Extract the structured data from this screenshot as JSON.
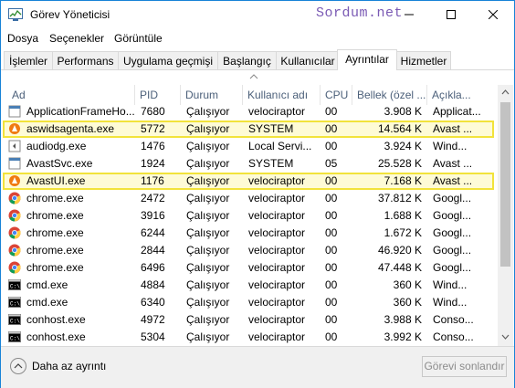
{
  "window": {
    "title": "Görev Yöneticisi",
    "watermark": "Sordum.net"
  },
  "menu": [
    "Dosya",
    "Seçenekler",
    "Görüntüle"
  ],
  "tabs": [
    "İşlemler",
    "Performans",
    "Uygulama geçmişi",
    "Başlangıç",
    "Kullanıcılar",
    "Ayrıntılar",
    "Hizmetler"
  ],
  "active_tab": "Ayrıntılar",
  "columns": [
    "Ad",
    "PID",
    "Durum",
    "Kullanıcı adı",
    "CPU",
    "Bellek (özel ...",
    "Açıkla..."
  ],
  "rows": [
    {
      "name": "ApplicationFrameHo...",
      "pid": "7680",
      "status": "Çalışıyor",
      "user": "velociraptor",
      "cpu": "00",
      "mem": "3.908 K",
      "desc": "Applicat...",
      "icon": "app-frame-icon",
      "highlight": false
    },
    {
      "name": "aswidsagenta.exe",
      "pid": "5772",
      "status": "Çalışıyor",
      "user": "SYSTEM",
      "cpu": "00",
      "mem": "14.564 K",
      "desc": "Avast ...",
      "icon": "avast-icon",
      "highlight": true
    },
    {
      "name": "audiodg.exe",
      "pid": "1476",
      "status": "Çalışıyor",
      "user": "Local Servi...",
      "cpu": "00",
      "mem": "3.924 K",
      "desc": "Wind...",
      "icon": "audio-icon",
      "highlight": false
    },
    {
      "name": "AvastSvc.exe",
      "pid": "1924",
      "status": "Çalışıyor",
      "user": "SYSTEM",
      "cpu": "05",
      "mem": "25.528 K",
      "desc": "Avast ...",
      "icon": "app-frame-icon",
      "highlight": false
    },
    {
      "name": "AvastUI.exe",
      "pid": "1176",
      "status": "Çalışıyor",
      "user": "velociraptor",
      "cpu": "00",
      "mem": "7.168 K",
      "desc": "Avast ...",
      "icon": "avast-icon",
      "highlight": true
    },
    {
      "name": "chrome.exe",
      "pid": "2472",
      "status": "Çalışıyor",
      "user": "velociraptor",
      "cpu": "00",
      "mem": "37.812 K",
      "desc": "Googl...",
      "icon": "chrome-icon",
      "highlight": false
    },
    {
      "name": "chrome.exe",
      "pid": "3916",
      "status": "Çalışıyor",
      "user": "velociraptor",
      "cpu": "00",
      "mem": "1.688 K",
      "desc": "Googl...",
      "icon": "chrome-icon",
      "highlight": false
    },
    {
      "name": "chrome.exe",
      "pid": "6244",
      "status": "Çalışıyor",
      "user": "velociraptor",
      "cpu": "00",
      "mem": "1.672 K",
      "desc": "Googl...",
      "icon": "chrome-icon",
      "highlight": false
    },
    {
      "name": "chrome.exe",
      "pid": "2844",
      "status": "Çalışıyor",
      "user": "velociraptor",
      "cpu": "00",
      "mem": "46.920 K",
      "desc": "Googl...",
      "icon": "chrome-icon",
      "highlight": false
    },
    {
      "name": "chrome.exe",
      "pid": "6496",
      "status": "Çalışıyor",
      "user": "velociraptor",
      "cpu": "00",
      "mem": "47.448 K",
      "desc": "Googl...",
      "icon": "chrome-icon",
      "highlight": false
    },
    {
      "name": "cmd.exe",
      "pid": "4884",
      "status": "Çalışıyor",
      "user": "velociraptor",
      "cpu": "00",
      "mem": "360 K",
      "desc": "Wind...",
      "icon": "cmd-icon",
      "highlight": false
    },
    {
      "name": "cmd.exe",
      "pid": "6340",
      "status": "Çalışıyor",
      "user": "velociraptor",
      "cpu": "00",
      "mem": "360 K",
      "desc": "Wind...",
      "icon": "cmd-icon",
      "highlight": false
    },
    {
      "name": "conhost.exe",
      "pid": "4972",
      "status": "Çalışıyor",
      "user": "velociraptor",
      "cpu": "00",
      "mem": "3.988 K",
      "desc": "Conso...",
      "icon": "cmd-icon",
      "highlight": false
    },
    {
      "name": "conhost.exe",
      "pid": "5304",
      "status": "Çalışıyor",
      "user": "velociraptor",
      "cpu": "00",
      "mem": "3.992 K",
      "desc": "Conso...",
      "icon": "cmd-icon",
      "highlight": false
    }
  ],
  "footer": {
    "less_details": "Daha az ayrıntı",
    "end_task": "Görevi sonlandır"
  },
  "colors": {
    "highlight_border": "#f2e33b",
    "highlight_fill": "#fefbd6",
    "window_border": "#1883d7",
    "header_text": "#4c607a"
  }
}
